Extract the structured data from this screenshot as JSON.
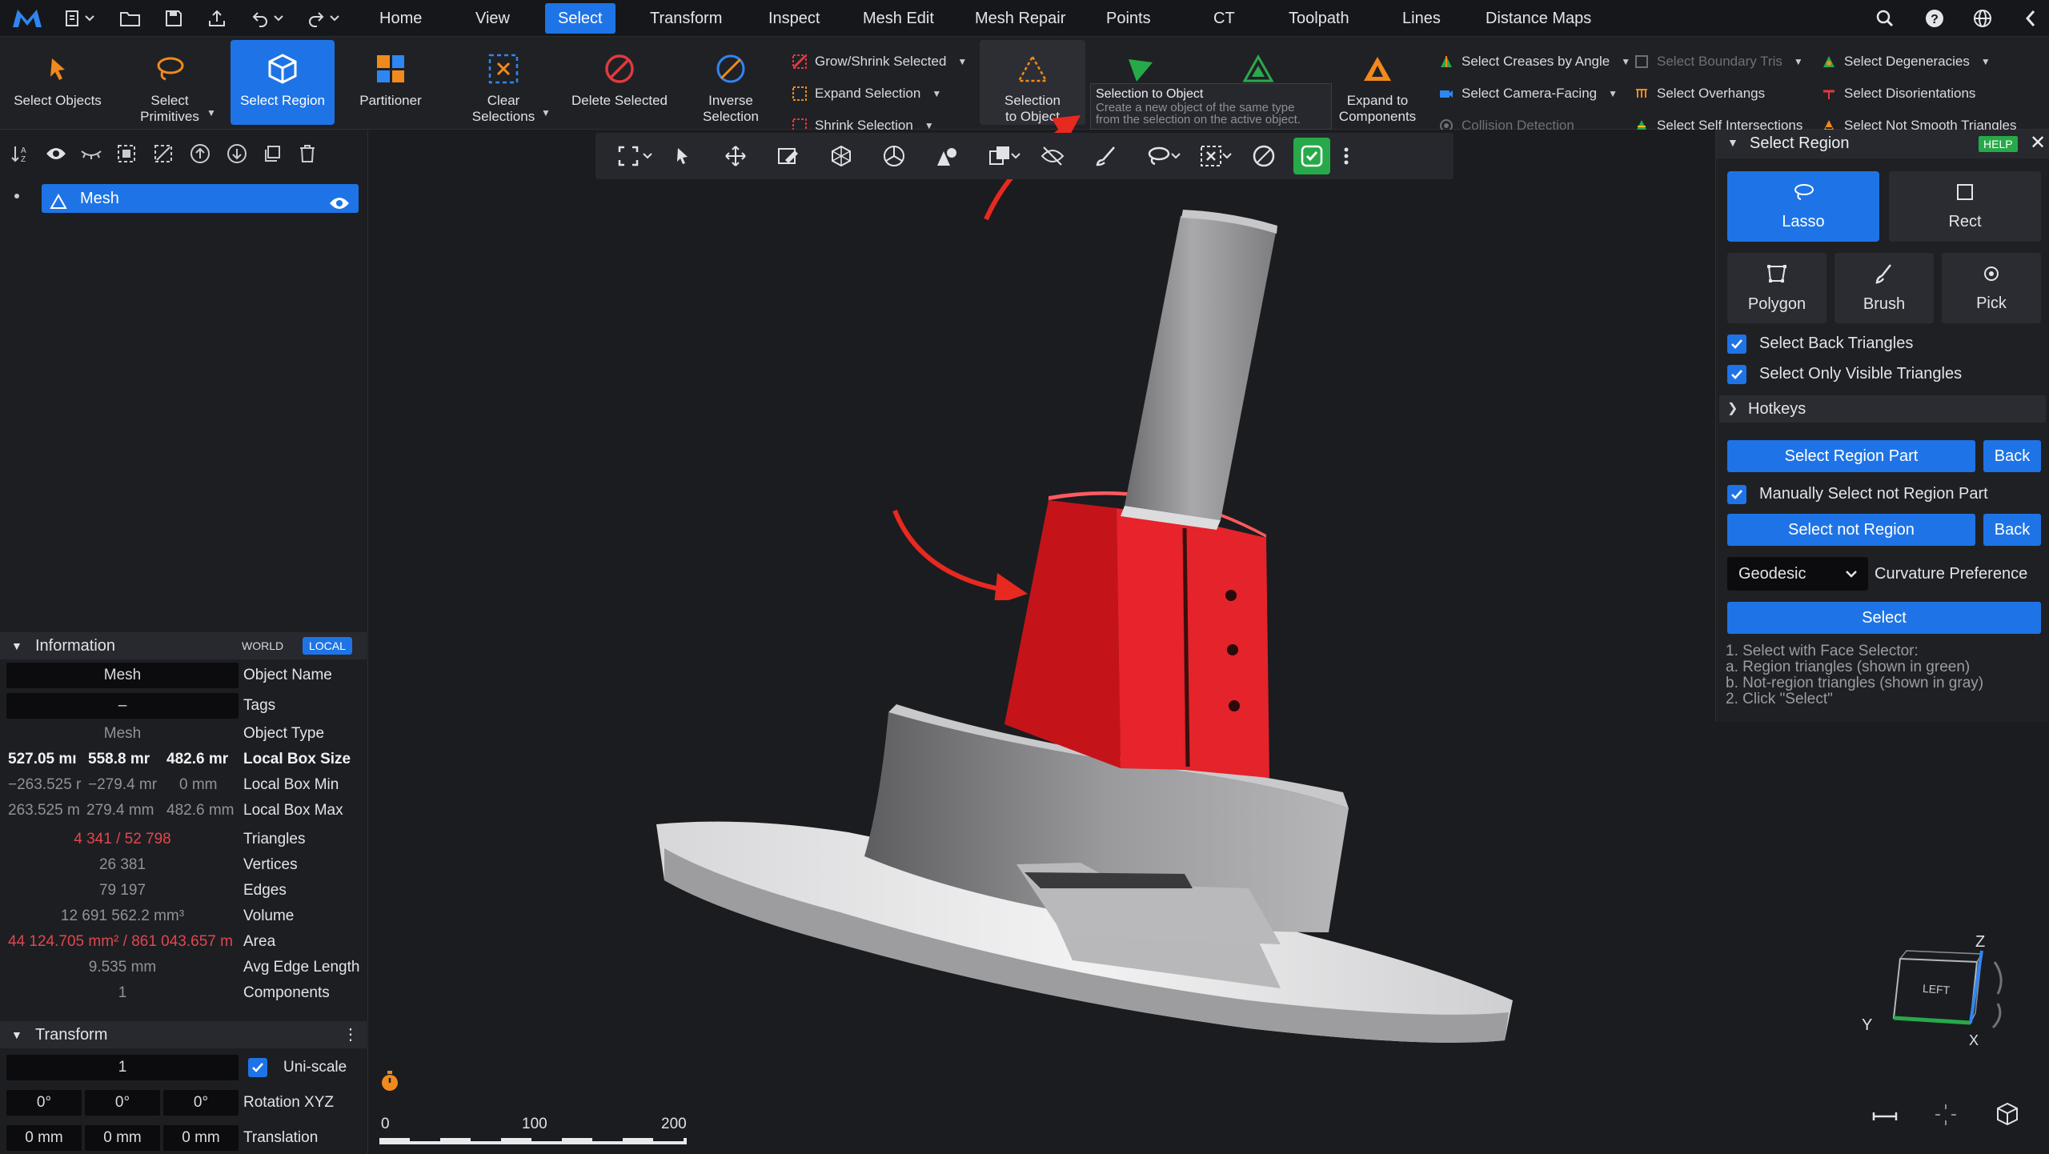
{
  "menu": {
    "tabs": [
      "Home",
      "View",
      "Select",
      "Transform",
      "Inspect",
      "Mesh Edit",
      "Mesh Repair",
      "Points",
      "CT",
      "Toolpath",
      "Lines",
      "Distance Maps"
    ],
    "active": "Select"
  },
  "ribbon": {
    "select_objects": "Select Objects",
    "select_primitives": "Select\nPrimitives",
    "select_region": "Select Region",
    "partitioner": "Partitioner",
    "clear_selections": "Clear\nSelections",
    "delete_selected": "Delete Selected",
    "inverse_selection": "Inverse\nSelection",
    "grow_shrink": "Grow/Shrink Selected",
    "expand_selection": "Expand Selection",
    "shrink_selection": "Shrink Selection",
    "selection_to_object": "Selection\nto Object",
    "expand_to_components": "Expand to\nComponents",
    "select_creases": "Select Creases by Angle",
    "select_camera_facing": "Select Camera-Facing",
    "collision_detection": "Collision Detection",
    "select_boundary_tris": "Select Boundary Tris",
    "select_overhangs": "Select Overhangs",
    "select_self_intersections": "Select Self Intersections",
    "select_degeneracies": "Select Degeneracies",
    "select_disorientations": "Select Disorientations",
    "select_not_smooth": "Select Not Smooth Triangles"
  },
  "tooltip": {
    "title": "Selection to Object",
    "desc1": "Create a new object of the same type",
    "desc2": "from the selection on the active object."
  },
  "scene": {
    "object_name": "Mesh"
  },
  "info": {
    "header": "Information",
    "world": "WORLD",
    "local": "LOCAL",
    "object_name_value": "Mesh",
    "object_name_label": "Object Name",
    "tags_value": "–",
    "tags_label": "Tags",
    "object_type_value": "Mesh",
    "object_type_label": "Object Type",
    "box_size": [
      "527.05 mı",
      "558.8 mr",
      "482.6 mr"
    ],
    "box_size_label": "Local Box Size",
    "box_min": [
      "−263.525 r",
      "−279.4 mr",
      "0 mm"
    ],
    "box_min_label": "Local Box Min",
    "box_max": [
      "263.525 m",
      "279.4 mm",
      "482.6 mm"
    ],
    "box_max_label": "Local Box Max",
    "triangles": "4 341 / 52 798",
    "triangles_label": "Triangles",
    "vertices": "26 381",
    "vertices_label": "Vertices",
    "edges": "79 197",
    "edges_label": "Edges",
    "volume": "12 691 562.2 mm³",
    "volume_label": "Volume",
    "area": "44 124.705 mm² / 861 043.657 m",
    "area_label": "Area",
    "avg_edge": "9.535 mm",
    "avg_edge_label": "Avg Edge Length",
    "components": "1",
    "components_label": "Components"
  },
  "transform": {
    "header": "Transform",
    "scale": "1",
    "uniscale_label": "Uni-scale",
    "rotation": [
      "0°",
      "0°",
      "0°"
    ],
    "rotation_label": "Rotation XYZ",
    "translation": [
      "0 mm",
      "0 mm",
      "0 mm"
    ],
    "translation_label": "Translation"
  },
  "ruler": {
    "labels": [
      "0",
      "100",
      "200"
    ]
  },
  "axes": {
    "z": "Z",
    "y": "Y",
    "x": "X",
    "cube_face": "LEFT"
  },
  "panel": {
    "title": "Select Region",
    "help": "HELP",
    "modes": [
      "Lasso",
      "Rect",
      "Polygon",
      "Brush",
      "Pick"
    ],
    "active_mode": "Lasso",
    "select_back": "Select Back Triangles",
    "select_visible": "Select Only Visible Triangles",
    "hotkeys": "Hotkeys",
    "select_region_part": "Select Region Part",
    "back": "Back",
    "manual_not_region": "Manually Select not Region Part",
    "select_not_region": "Select not Region",
    "geodesic": "Geodesic",
    "curvature_pref": "Curvature Preference",
    "select": "Select",
    "help_lines": [
      "1. Select with Face Selector:",
      " a. Region triangles (shown in green)",
      " b. Not-region triangles (shown in gray)",
      "2. Click \"Select\""
    ]
  },
  "colors": {
    "accent": "#1e74e6",
    "selection": "#e8232b",
    "annotation_arrow": "#e8291f"
  }
}
